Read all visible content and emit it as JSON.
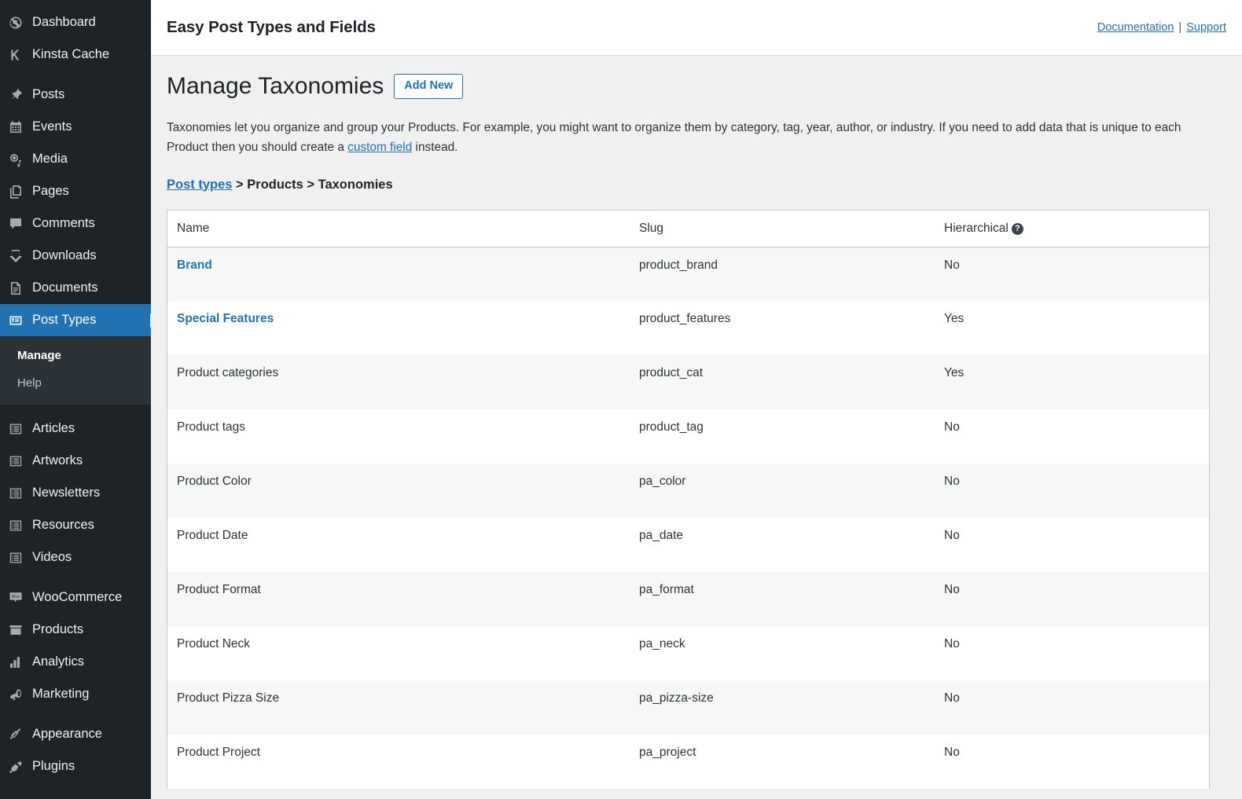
{
  "sidebar": {
    "items": [
      {
        "label": "Dashboard",
        "icon": "dashboard-icon",
        "group": 0
      },
      {
        "label": "Kinsta Cache",
        "icon": "kinsta-icon",
        "group": 0
      },
      {
        "label": "Posts",
        "icon": "pin-icon",
        "group": 1
      },
      {
        "label": "Events",
        "icon": "calendar-icon",
        "group": 1
      },
      {
        "label": "Media",
        "icon": "media-icon",
        "group": 1
      },
      {
        "label": "Pages",
        "icon": "pages-icon",
        "group": 1
      },
      {
        "label": "Comments",
        "icon": "comments-icon",
        "group": 1
      },
      {
        "label": "Downloads",
        "icon": "download-icon",
        "group": 1
      },
      {
        "label": "Documents",
        "icon": "document-icon",
        "group": 1
      },
      {
        "label": "Post Types",
        "icon": "post-types-icon",
        "group": 1,
        "active": true
      },
      {
        "label": "Articles",
        "icon": "list-icon",
        "group": 2
      },
      {
        "label": "Artworks",
        "icon": "list-icon",
        "group": 2
      },
      {
        "label": "Newsletters",
        "icon": "list-icon",
        "group": 2
      },
      {
        "label": "Resources",
        "icon": "list-icon",
        "group": 2
      },
      {
        "label": "Videos",
        "icon": "list-icon",
        "group": 2
      },
      {
        "label": "WooCommerce",
        "icon": "woo-icon",
        "group": 3
      },
      {
        "label": "Products",
        "icon": "products-icon",
        "group": 3
      },
      {
        "label": "Analytics",
        "icon": "analytics-icon",
        "group": 3
      },
      {
        "label": "Marketing",
        "icon": "marketing-icon",
        "group": 3
      },
      {
        "label": "Appearance",
        "icon": "appearance-icon",
        "group": 4
      },
      {
        "label": "Plugins",
        "icon": "plugins-icon",
        "group": 4
      }
    ],
    "submenu": {
      "items": [
        {
          "label": "Manage",
          "current": true
        },
        {
          "label": "Help",
          "current": false
        }
      ]
    }
  },
  "topbar": {
    "title": "Easy Post Types and Fields",
    "documentation_label": "Documentation",
    "separator": "|",
    "support_label": "Support"
  },
  "page": {
    "title": "Manage Taxonomies",
    "add_new_label": "Add New",
    "description_part1": "Taxonomies let you organize and group your Products. For example, you might want to organize them by category, tag, year, author, or industry. If you need to add data that is unique to each Product then you should create a ",
    "description_link": "custom field",
    "description_part2": " instead.",
    "breadcrumb": {
      "root": "Post types",
      "sep1": " > ",
      "level2": "Products",
      "sep2": " > ",
      "level3": "Taxonomies"
    }
  },
  "table": {
    "columns": [
      "Name",
      "Slug",
      "Hierarchical"
    ],
    "hierarchical_help_glyph": "?",
    "rows": [
      {
        "name": "Brand",
        "slug": "product_brand",
        "hierarchical": "No",
        "is_link": true
      },
      {
        "name": "Special Features",
        "slug": "product_features",
        "hierarchical": "Yes",
        "is_link": true
      },
      {
        "name": "Product categories",
        "slug": "product_cat",
        "hierarchical": "Yes",
        "is_link": false
      },
      {
        "name": "Product tags",
        "slug": "product_tag",
        "hierarchical": "No",
        "is_link": false
      },
      {
        "name": "Product Color",
        "slug": "pa_color",
        "hierarchical": "No",
        "is_link": false
      },
      {
        "name": "Product Date",
        "slug": "pa_date",
        "hierarchical": "No",
        "is_link": false
      },
      {
        "name": "Product Format",
        "slug": "pa_format",
        "hierarchical": "No",
        "is_link": false
      },
      {
        "name": "Product Neck",
        "slug": "pa_neck",
        "hierarchical": "No",
        "is_link": false
      },
      {
        "name": "Product Pizza Size",
        "slug": "pa_pizza-size",
        "hierarchical": "No",
        "is_link": false
      },
      {
        "name": "Product Project",
        "slug": "pa_project",
        "hierarchical": "No",
        "is_link": false
      }
    ]
  },
  "colors": {
    "sidebar_bg": "#1d2327",
    "submenu_bg": "#2c3338",
    "accent": "#2271b1",
    "page_bg": "#f0f0f1",
    "row_alt_bg": "#f6f7f7",
    "border": "#c3c4c7"
  }
}
